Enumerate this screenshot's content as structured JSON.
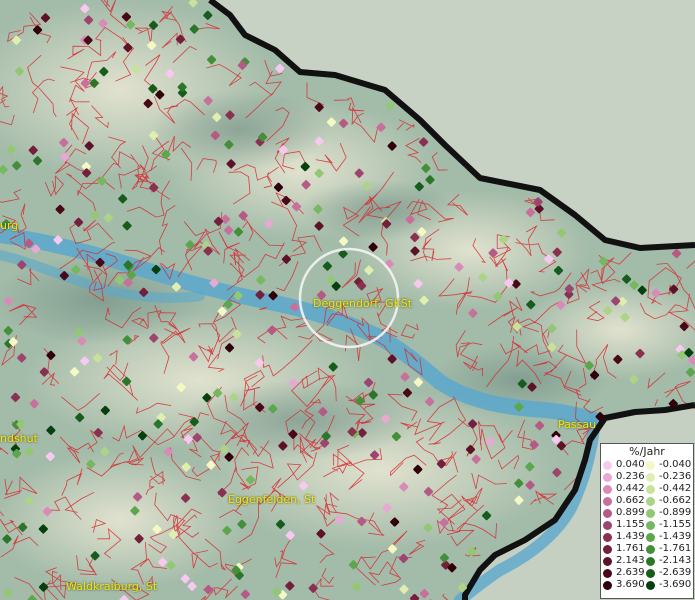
{
  "places": [
    {
      "name": "Deggendorf_GKSt",
      "label": "Deggendorf, GKSt"
    },
    {
      "name": "Passau",
      "label": "Passau"
    },
    {
      "name": "Landshut",
      "label": "ndshut"
    },
    {
      "name": "Eggenfelden",
      "label": "Eggenfelden, St"
    },
    {
      "name": "Waldkraiburg",
      "label": "Waldkraiburg, St"
    },
    {
      "name": "Straubing",
      "label": "urg"
    }
  ],
  "legend": {
    "title": "%/Jahr",
    "positive": [
      "0.040",
      "0.236",
      "0.442",
      "0.662",
      "0.899",
      "1.155",
      "1.439",
      "1.761",
      "2.143",
      "2.639",
      "3.690"
    ],
    "negative": [
      "-0.040",
      "-0.236",
      "-0.442",
      "-0.662",
      "-0.899",
      "-1.155",
      "-1.439",
      "-1.761",
      "-2.143",
      "-2.639",
      "-3.690"
    ],
    "positive_colors": [
      "#f7c8f0",
      "#e8a8d4",
      "#d98bb8",
      "#c8709c",
      "#b55a84",
      "#9e4470",
      "#8a3050",
      "#741f3c",
      "#5e1228",
      "#480818",
      "#30000a"
    ],
    "negative_colors": [
      "#f4f8c4",
      "#e0eeb0",
      "#c8e29c",
      "#acd488",
      "#92c874",
      "#76b860",
      "#5ca64c",
      "#438f3a",
      "#2c762a",
      "#175c1c",
      "#06400e"
    ]
  }
}
